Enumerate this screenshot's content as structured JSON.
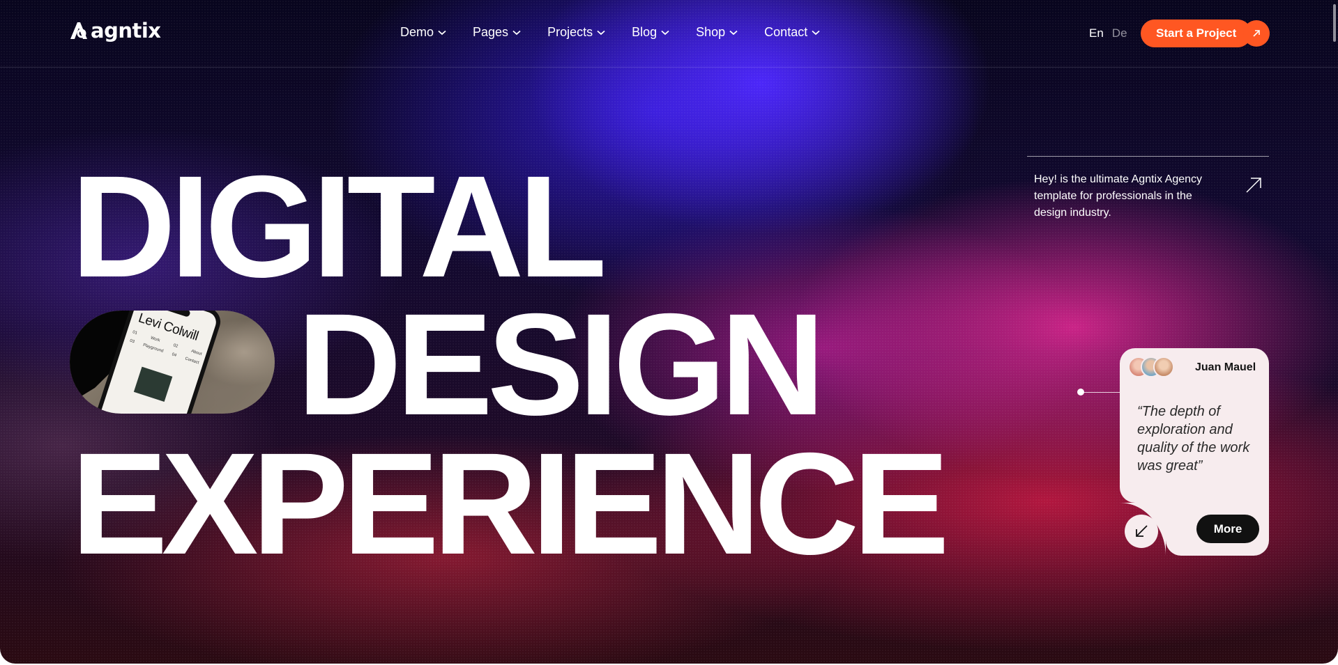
{
  "brand": {
    "name": "agntix"
  },
  "nav": {
    "items": [
      {
        "label": "Demo"
      },
      {
        "label": "Pages"
      },
      {
        "label": "Projects"
      },
      {
        "label": "Blog"
      },
      {
        "label": "Shop"
      },
      {
        "label": "Contact"
      }
    ]
  },
  "language": {
    "active": "En",
    "other": "De"
  },
  "cta": {
    "label": "Start a Project"
  },
  "hero": {
    "line1": "DIGITAL",
    "line2": "DESIGN",
    "line3": "EXPERIENCE",
    "intro": "Hey! is the ultimate Agntix Agency template for professionals in the design industry."
  },
  "phone_mockup": {
    "title": "Levi Colwill",
    "menu": [
      {
        "num": "01",
        "label": "Work"
      },
      {
        "num": "02",
        "label": "About"
      },
      {
        "num": "03",
        "label": "Playground"
      },
      {
        "num": "04",
        "label": "Contact"
      }
    ]
  },
  "testimonial": {
    "name": "Juan Mauel",
    "quote": "“The depth of exploration and quality of the work was great”",
    "more_label": "More"
  },
  "colors": {
    "accent": "#ff5722",
    "card": "#f7ecee",
    "dark": "#111111"
  }
}
